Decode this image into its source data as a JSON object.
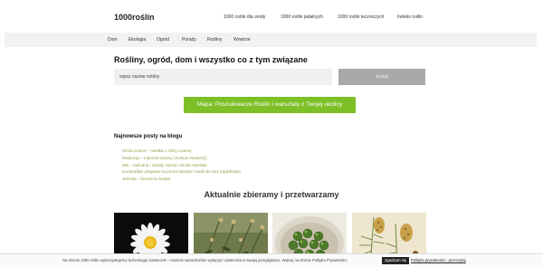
{
  "site": {
    "logo": "1000roślin"
  },
  "top_nav": [
    {
      "label": "1000 roślin dla urody"
    },
    {
      "label": "1000 roślin jadalnych"
    },
    {
      "label": "1000 roślin leczniczych"
    },
    {
      "label": "Indeks roślin"
    }
  ],
  "main_nav": [
    {
      "label": "Dom"
    },
    {
      "label": "Ekologia"
    },
    {
      "label": "Ogród"
    },
    {
      "label": "Porady"
    },
    {
      "label": "Rośliny"
    },
    {
      "label": "Wnętrze"
    }
  ],
  "hero": {
    "headline": "Rośliny, ogród, dom i wszystko co z tym związane",
    "search_value": "wpisz nazwę rośliny",
    "search_button": "szukaj",
    "map_button": "Mapa: Poszukiwacze Roślin i warsztaty z Twojej okolicy"
  },
  "posts": {
    "title": "Najnowsze posty na blogu",
    "items": [
      "Olcha czarna – nawłka z olchy czarnej",
      "Nasturcja – macerat octowy (Acetum Nasturcji)",
      "Mirt – kulinaria i rytuały. Myrtol i Woda Anielska",
      "Kozieradka: preparat na porost włosów i tonik do cery trądzikowej",
      "Jemioła – lecznicza święta"
    ]
  },
  "section": {
    "title": "Aktualnie zbieramy i przetwarzamy"
  },
  "thumbs": [
    {
      "icon": "chamomile-photo"
    },
    {
      "icon": "herb-stems-photo"
    },
    {
      "icon": "green-berries-photo"
    },
    {
      "icon": "botanical-illustration"
    }
  ],
  "cookie": {
    "text": "Na stronie 1000 roślin wykorzystujemy technologię ciasteczek – możesz samodzielnie wyłączyć ciasteczka w swojej przeglądarce. Więcej na stronie Polityka Prywatności",
    "accept": "Zgadzam się",
    "policy_link": "Polityka prywatności - przeczytaj"
  },
  "colors": {
    "accent": "#7cbf26",
    "link": "#8aa34a"
  }
}
